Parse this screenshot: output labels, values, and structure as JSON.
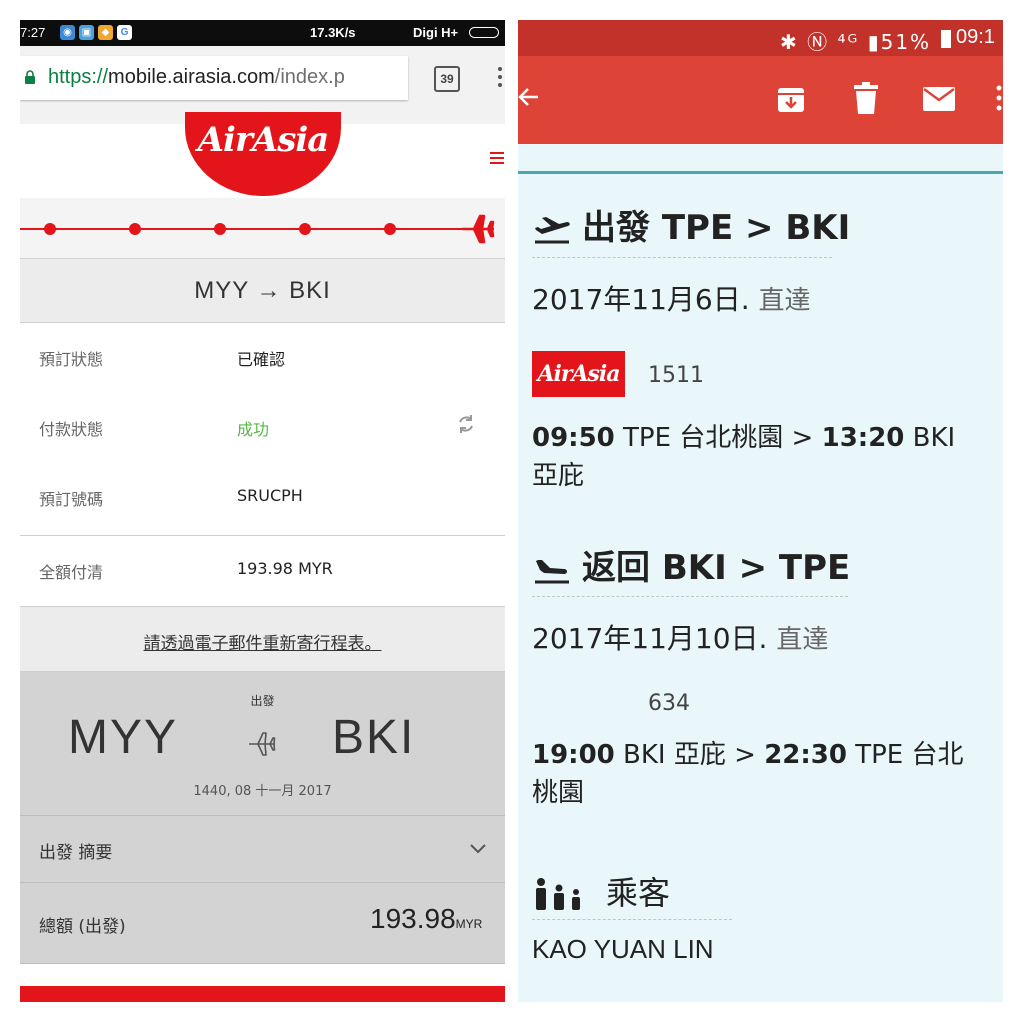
{
  "left": {
    "status_bar": {
      "time": "7:27",
      "speed": "17.3K/s",
      "carrier": "Digi H+"
    },
    "browser": {
      "url_scheme": "https://",
      "url_host": "mobile.airasia.com",
      "url_path": "/index.p",
      "tab_count": "39",
      "page_load_progress": 0.83
    },
    "header": {
      "logo_text": "AirAsia",
      "brand_color": "#e3151a"
    },
    "route_title": "MYY → BKI",
    "booking": {
      "rows": [
        {
          "key": "預訂狀態",
          "value": "已確認"
        },
        {
          "key": "付款狀態",
          "value": "成功",
          "status_color": "#59b843"
        },
        {
          "key": "預訂號碼",
          "value": "SRUCPH"
        },
        {
          "key": "全額付清",
          "value": "193.98 MYR"
        }
      ]
    },
    "resend_link": "請透過電子郵件重新寄行程表。",
    "flight_card": {
      "label": "出發",
      "from": "MYY",
      "to": "BKI",
      "datetime": "1440, 08 十一月 2017"
    },
    "summary_label": "出發 摘要",
    "total": {
      "label": "總額 (出發)",
      "amount": "193.98",
      "currency": "MYR"
    }
  },
  "right": {
    "status_bar": {
      "battery": "51%",
      "clock": "09:1"
    },
    "departure": {
      "title": "出發 TPE > BKI",
      "date": "2017年11月6日.",
      "nonstop": "直達",
      "airline_logo": "AirAsia",
      "flight_no": "1511",
      "dep_time": "09:50",
      "dep_place": "TPE 台北桃園",
      "arr_time": "13:20",
      "arr_place": "BKI 亞庇"
    },
    "return": {
      "title": "返回 BKI > TPE",
      "date": "2017年11月10日.",
      "nonstop": "直達",
      "flight_no": "634",
      "dep_time": "19:00",
      "dep_place": "BKI 亞庇",
      "arr_time": "22:30",
      "arr_place": "TPE 台北桃園"
    },
    "passengers": {
      "title": "乘客",
      "name": "KAO YUAN LIN"
    }
  }
}
